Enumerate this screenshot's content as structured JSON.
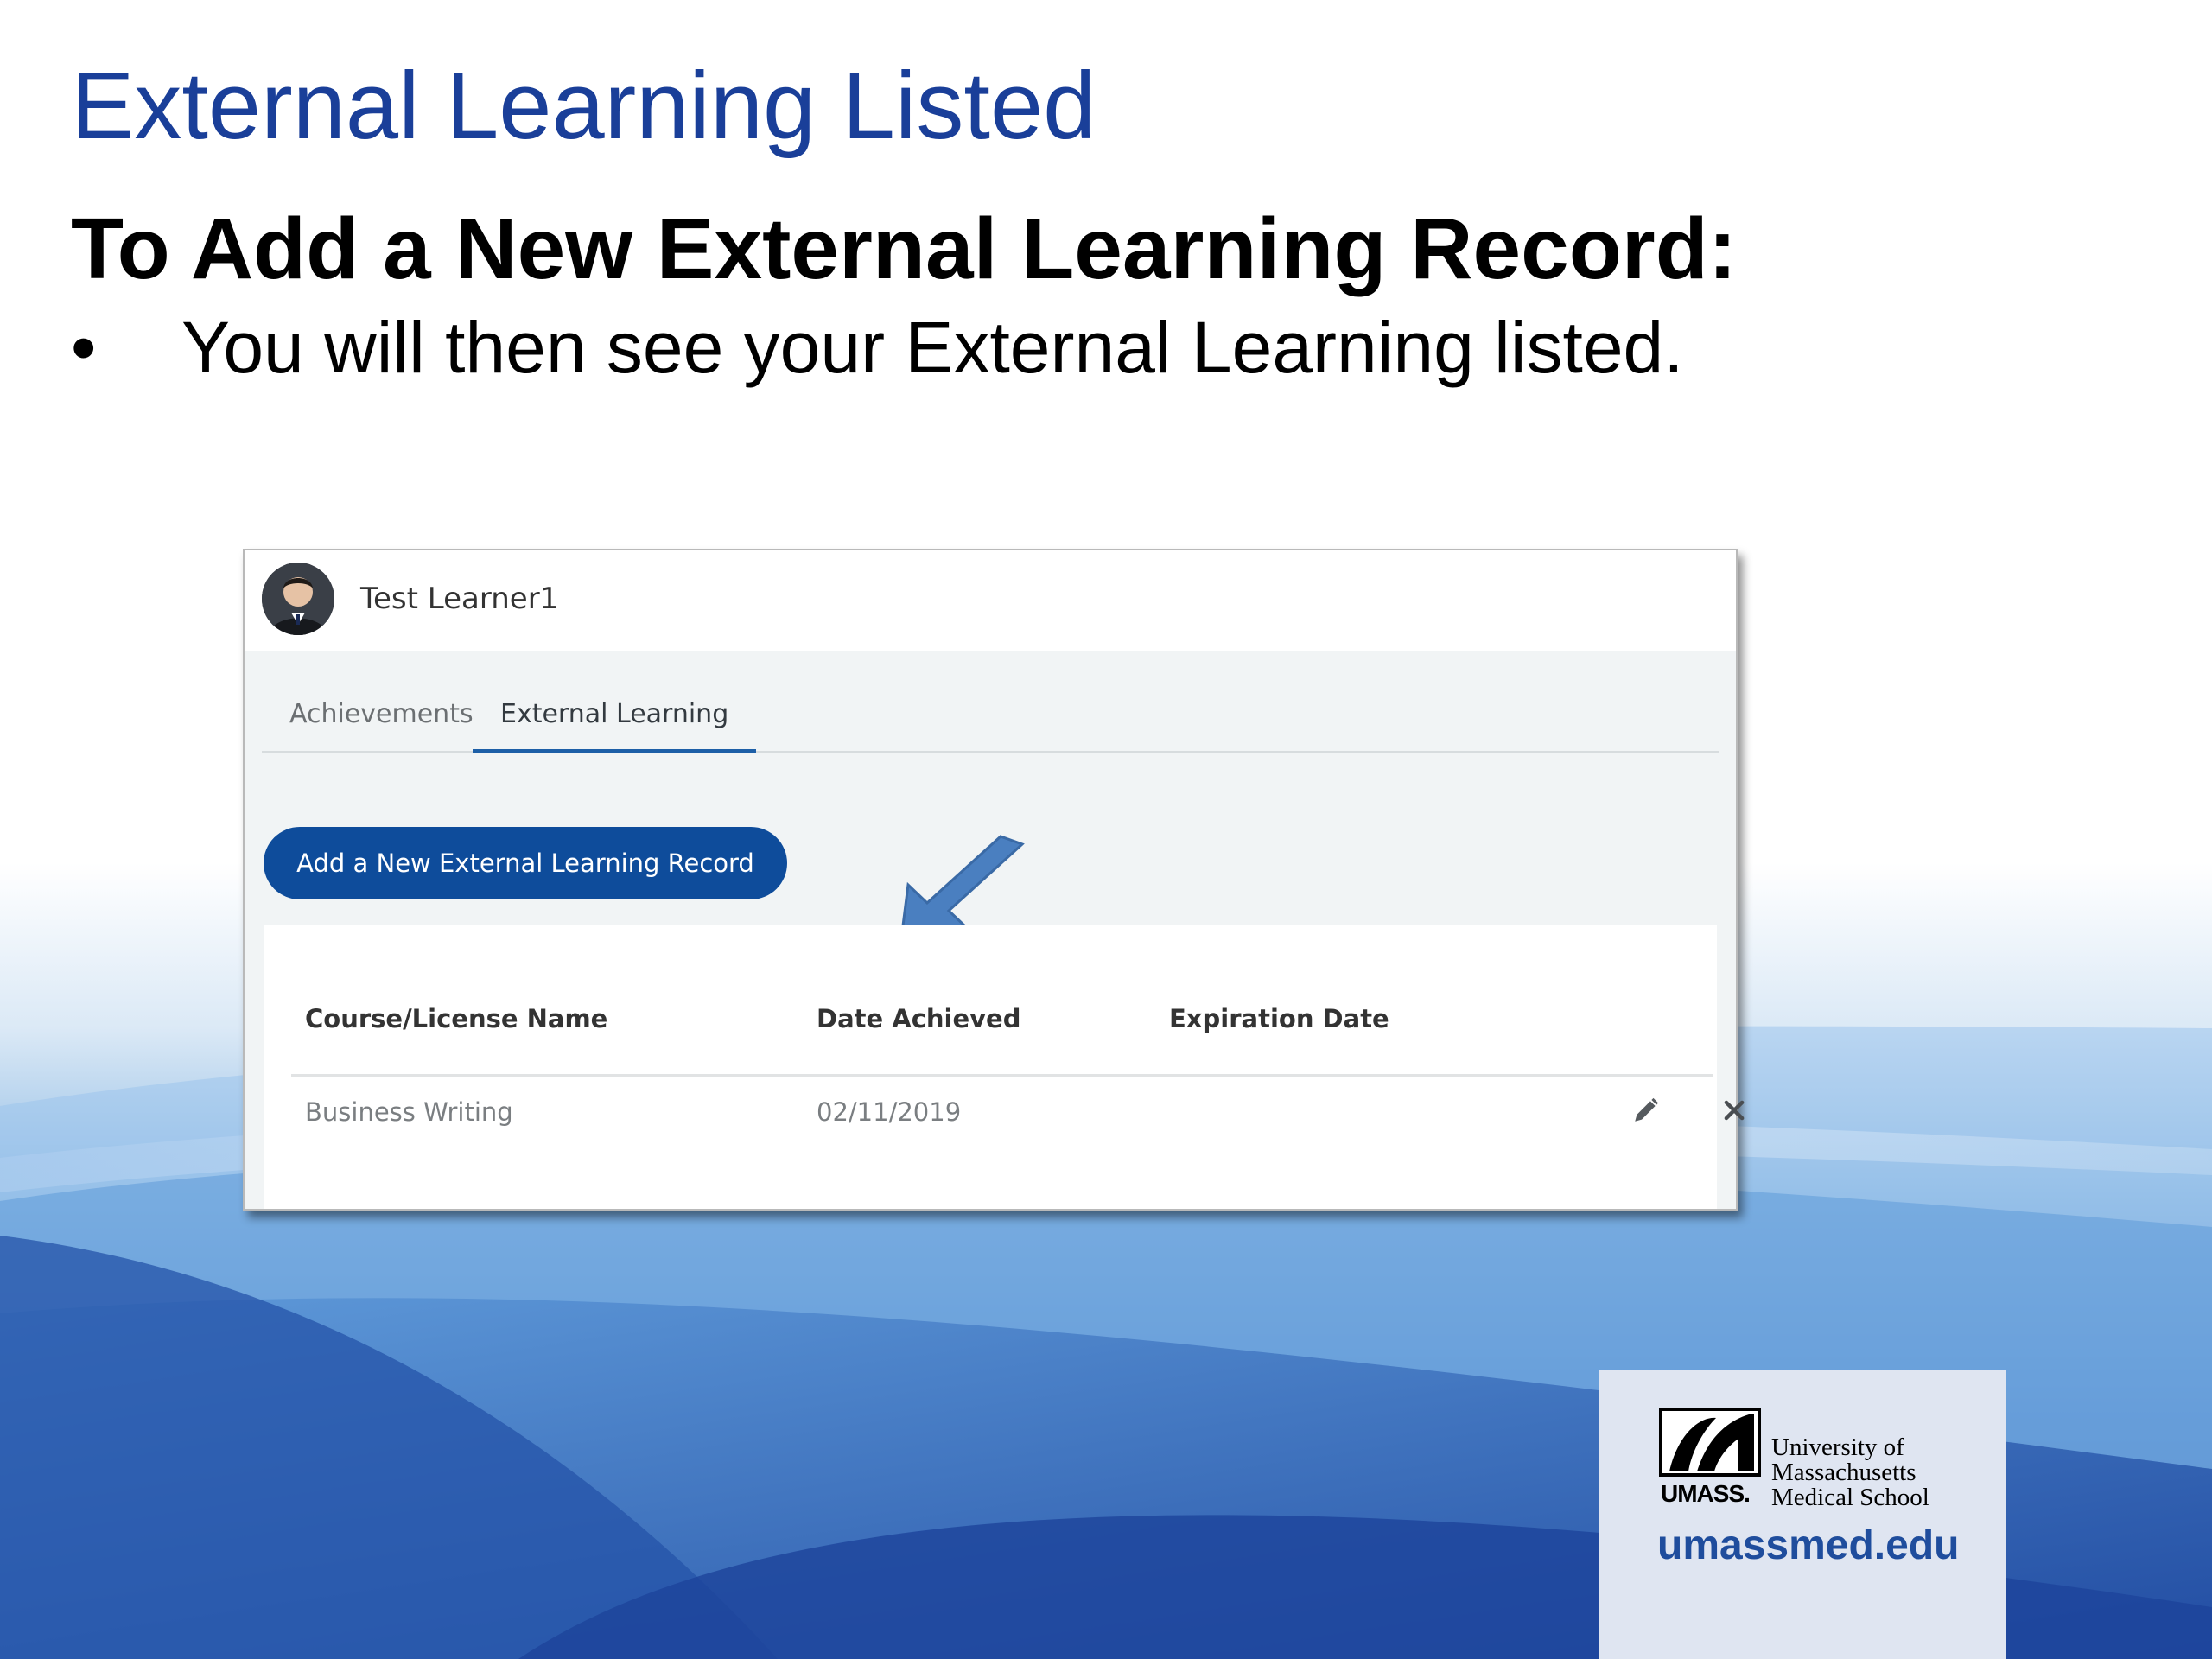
{
  "slide": {
    "title": "External Learning Listed",
    "subtitle": "To Add a New External Learning Record:",
    "bullet": "You will then see your External Learning listed.",
    "bullet_symbol": "•"
  },
  "app": {
    "user_name": "Test Learner1",
    "tabs": [
      {
        "label": "Achievements",
        "active": false
      },
      {
        "label": "External Learning",
        "active": true
      }
    ],
    "add_button_label": "Add a New External Learning Record",
    "table": {
      "headers": [
        "Course/License Name",
        "Date Achieved",
        "Expiration Date"
      ],
      "rows": [
        {
          "name": "Business Writing",
          "date_achieved": "02/11/2019",
          "expiration_date": ""
        }
      ]
    }
  },
  "logo": {
    "wordmark": "UMASS.",
    "lines": [
      "University of",
      "Massachusetts",
      "Medical School"
    ],
    "url": "umassmed.edu"
  },
  "colors": {
    "title_blue": "#1a3f99",
    "button_blue": "#0e4c9b",
    "arrow_blue": "#4a7fc0",
    "tab_underline": "#1d5fa7"
  },
  "icons": {
    "edit": "pencil-icon",
    "delete": "close-icon",
    "pointer": "arrow-down-left-icon"
  }
}
